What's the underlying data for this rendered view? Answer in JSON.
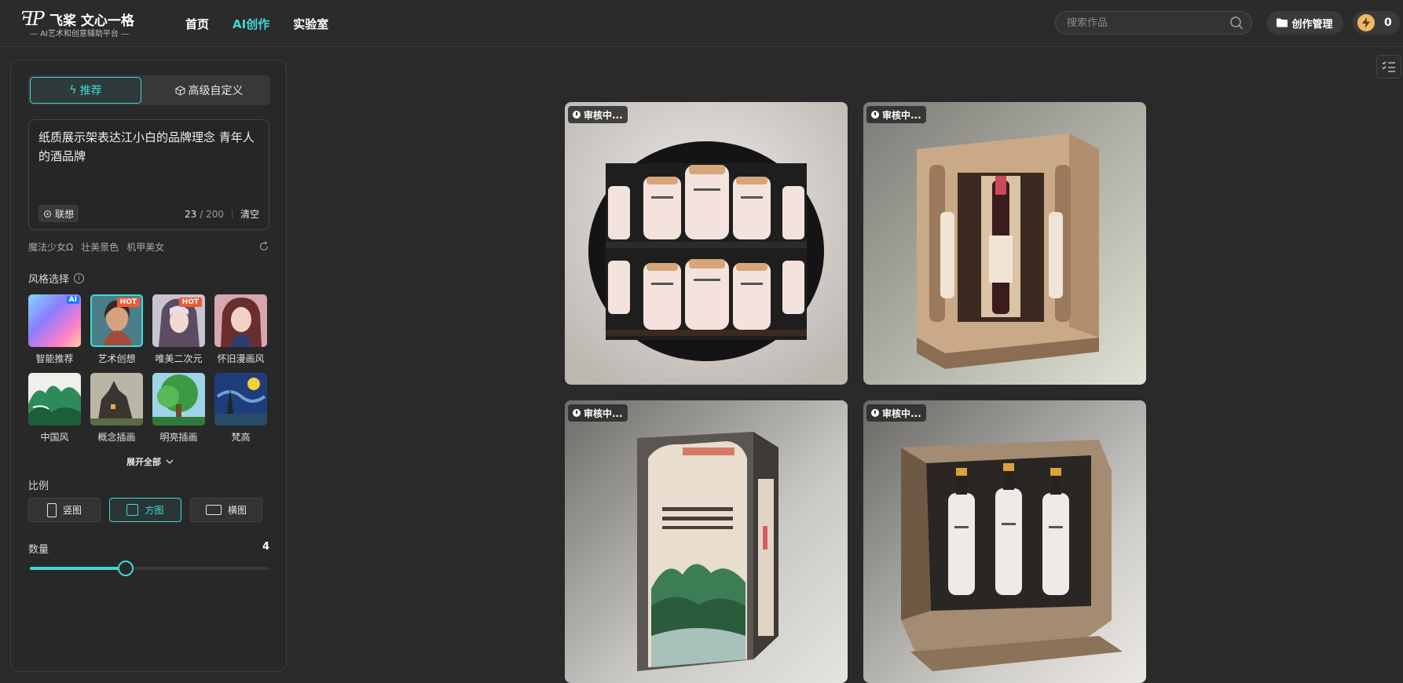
{
  "header": {
    "logo_mark": "ꟻP",
    "logo_name": "飞桨 文心一格",
    "logo_sub": "AI艺术和创意辅助平台",
    "nav": [
      {
        "label": "首页",
        "active": false
      },
      {
        "label": "AI创作",
        "active": true
      },
      {
        "label": "实验室",
        "active": false
      }
    ],
    "search_placeholder": "搜索作品",
    "manage_label": "创作管理",
    "credits": "0"
  },
  "panel": {
    "tabs": {
      "recommend": "推荐",
      "advanced": "高级自定义"
    },
    "prompt": {
      "value": "纸质展示架表达江小白的品牌理念 青年人的酒品牌",
      "assoc_label": "联想",
      "count": "23",
      "max": "/ 200",
      "clear_label": "清空"
    },
    "hints": [
      "魔法少女Ω",
      "壮美景色",
      "机甲美女"
    ],
    "style_title": "风格选择",
    "styles": [
      {
        "label": "智能推荐",
        "badge": "AI"
      },
      {
        "label": "艺术创想",
        "badge": "HOT"
      },
      {
        "label": "唯美二次元",
        "badge": "HOT"
      },
      {
        "label": "怀旧漫画风",
        "badge": ""
      },
      {
        "label": "中国风",
        "badge": ""
      },
      {
        "label": "概念插画",
        "badge": ""
      },
      {
        "label": "明亮插画",
        "badge": ""
      },
      {
        "label": "梵高",
        "badge": ""
      }
    ],
    "expand_label": "展开全部",
    "ratio_title": "比例",
    "ratios": [
      "竖图",
      "方图",
      "横图"
    ],
    "selected_ratio": "方图",
    "quantity_title": "数量",
    "quantity_value": "4",
    "quantity_level": 0.4
  },
  "gallery": [
    {
      "status": "审核中..."
    },
    {
      "status": "审核中..."
    },
    {
      "status": "审核中..."
    },
    {
      "status": "审核中..."
    }
  ],
  "colors": {
    "accent": "#3fd9d6",
    "background": "#2a2a2a",
    "hot_badge": "#f05a32"
  }
}
